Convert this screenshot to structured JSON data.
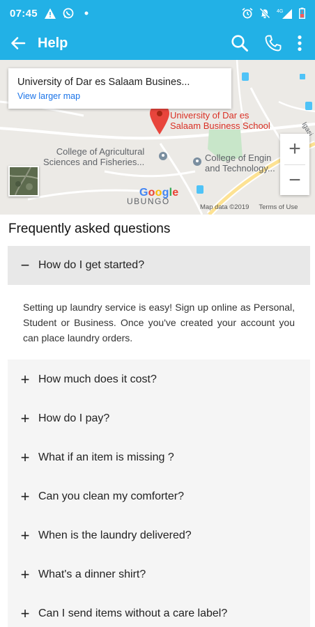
{
  "status_bar": {
    "time": "07:45",
    "left_icons": [
      "warning-icon",
      "whatsapp-icon",
      "dot-icon"
    ],
    "right_icons": [
      "alarm-icon",
      "mute-icon",
      "signal-icon",
      "battery-icon"
    ],
    "network": "4G"
  },
  "app_bar": {
    "title": "Help",
    "back_icon": "back-arrow-icon",
    "actions": [
      "search-icon",
      "phone-icon",
      "more-vert-icon"
    ]
  },
  "map": {
    "card_title": "University of Dar es Salaam Busines...",
    "card_link": "View larger map",
    "pin_label_line1": "University of Dar es",
    "pin_label_line2": "Salaam Business School",
    "label_agri_line1": "College of Agricultural",
    "label_agri_line2": "Sciences and Fisheries...",
    "label_eng_line1": "College of Engin",
    "label_eng_line2": "and Technology...",
    "label_area": "UBUNGO",
    "label_road": "Igasi",
    "google_text": "Google",
    "attribution": "Map data ©2019",
    "terms": "Terms of Use",
    "zoom_in": "+",
    "zoom_out": "−"
  },
  "faq": {
    "heading": "Frequently asked questions",
    "open_sign": "−",
    "closed_sign": "+",
    "open_question": "How do I get started?",
    "open_answer": "Setting up laundry service is easy! Sign up online as Personal, Student or Business. Once you've created your account you can place laundry orders.",
    "questions": [
      "How much does it cost?",
      "How do I pay?",
      "What if an item is missing ?",
      "Can you clean my comforter?",
      "When is the laundry delivered?",
      "What's a dinner shirt?",
      "Can I send items without a care label?"
    ]
  },
  "colors": {
    "primary": "#22b1e6",
    "pin": "#e8453c",
    "link": "#1a73e8"
  }
}
